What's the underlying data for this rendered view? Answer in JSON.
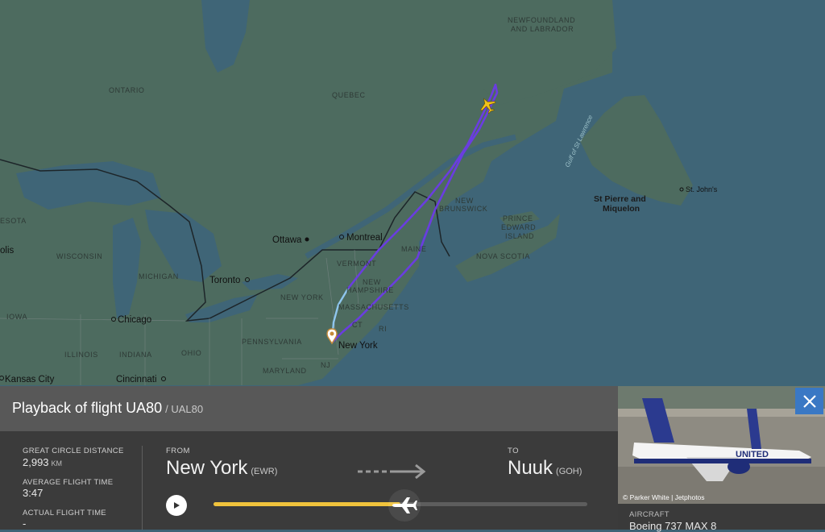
{
  "map": {
    "regions": [
      "NEWFOUNDLAND",
      "AND LABRADOR",
      "ONTARIO",
      "QUEBEC",
      "NEW",
      "BRUNSWICK",
      "PRINCE",
      "EDWARD",
      "ISLAND",
      "NOVA SCOTIA",
      "WISCONSIN",
      "MICHIGAN",
      "NEW YORK",
      "VERMONT",
      "NEW",
      "HAMPSHIRE",
      "MASSACHUSETTS",
      "MAINE",
      "IOWA",
      "ILLINOIS",
      "INDIANA",
      "OHIO",
      "PENNSYLVANIA",
      "MARYLAND",
      "NJ",
      "CT",
      "RI",
      "ESOTA"
    ],
    "cities": [
      "Ottawa",
      "Montreal",
      "Toronto",
      "Chicago",
      "New York",
      "Kansas City",
      "Cincinnati",
      "St. John's",
      "olis"
    ],
    "islands": [
      "St Pierre and",
      "Miquelon"
    ],
    "water": [
      "Gulf of St Lawrence"
    ],
    "colors": {
      "land": "#4d6b5f",
      "water": "#3f6577",
      "track": "#6a3de0",
      "track_start": "#8fc6ee"
    }
  },
  "panel": {
    "title": "Playback of flight UA80",
    "callsign": "/ UAL80",
    "stats": {
      "distance_label": "GREAT CIRCLE DISTANCE",
      "distance_value": "2,993",
      "distance_unit": "KM",
      "avg_time_label": "AVERAGE FLIGHT TIME",
      "avg_time_value": "3:47",
      "actual_time_label": "ACTUAL FLIGHT TIME",
      "actual_time_value": "-"
    },
    "from_label": "FROM",
    "from_city": "New York",
    "from_code": "(EWR)",
    "to_label": "TO",
    "to_city": "Nuuk",
    "to_code": "(GOH)",
    "playback_progress": 0.5,
    "colors": {
      "progress": "#f0c33c",
      "accent": "#3a78c4"
    }
  },
  "side": {
    "photo_credit": "© Parker White | Jetphotos",
    "aircraft_label": "AIRCRAFT",
    "aircraft_value": "Boeing 737 MAX 8",
    "livery_text": "UNITED"
  },
  "icons": [
    "play-icon",
    "close-icon",
    "plane-icon",
    "arrow-right-icon",
    "origin-pin-icon"
  ]
}
